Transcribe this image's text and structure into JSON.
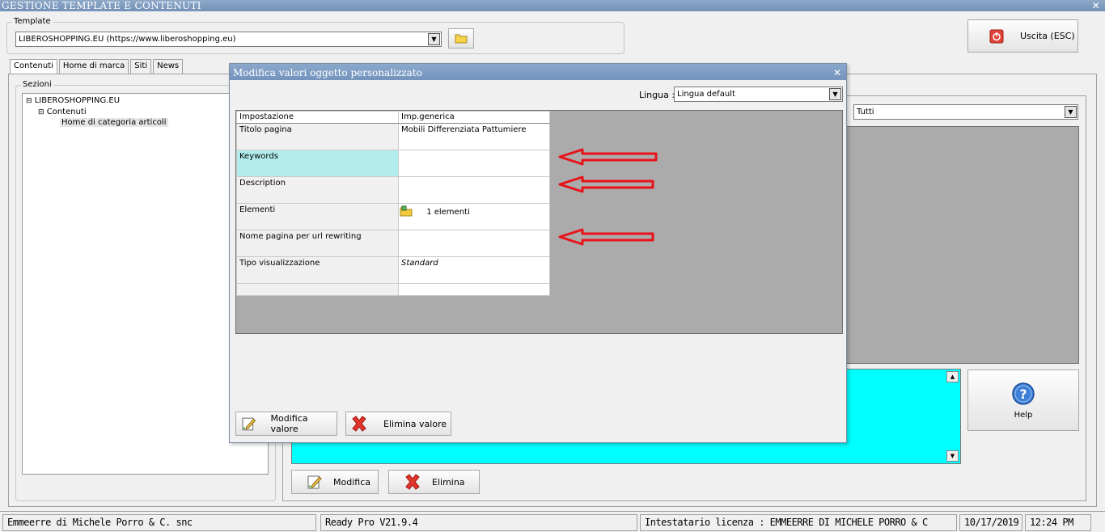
{
  "window": {
    "title": "GESTIONE TEMPLATE E CONTENUTI",
    "close_glyph": "✕"
  },
  "template": {
    "group_label": "Template",
    "selected": "LIBEROSHOPPING.EU (https://www.liberoshopping.eu)"
  },
  "exit_button": {
    "label": "Uscita (ESC)"
  },
  "tabs": [
    {
      "label": "Contenuti"
    },
    {
      "label": "Home di marca"
    },
    {
      "label": "Siti"
    },
    {
      "label": "News"
    }
  ],
  "sections": {
    "group_label": "Sezioni",
    "tree": {
      "root": "LIBEROSHOPPING.EU",
      "child": "Contenuti",
      "leaf": "Home di categoria articoli"
    }
  },
  "right_panel": {
    "filter_selected": "Tutti"
  },
  "help_button": {
    "label": "Help"
  },
  "bottom_buttons": {
    "edit": "Modifica",
    "delete": "Elimina"
  },
  "dialog": {
    "title": "Modifica valori oggetto personalizzato",
    "close_glyph": "✕",
    "language_label": "Lingua :",
    "language_selected": "Lingua default",
    "columns": [
      "Impostazione",
      "Imp.generica"
    ],
    "rows": [
      {
        "setting": "Titolo pagina",
        "value": "Mobili Differenziata Pattumiere"
      },
      {
        "setting": "Keywords",
        "value": ""
      },
      {
        "setting": "Description",
        "value": ""
      },
      {
        "setting": "Elementi",
        "value": "1 elementi"
      },
      {
        "setting": "Nome pagina per url rewriting",
        "value": ""
      },
      {
        "setting": "Tipo visualizzazione",
        "value": "Standard"
      },
      {
        "setting": "",
        "value": ""
      }
    ],
    "edit_button": "Modifica valore",
    "delete_button": "Elimina valore"
  },
  "status": {
    "company": "Emmeerre di Michele Porro & C. snc",
    "version": "Ready Pro V21.9.4",
    "license": "Intestatario licenza : EMMEERRE DI MICHELE PORRO & C",
    "date": "10/17/2019",
    "time": "12:24 PM"
  },
  "colors": {
    "titlebar": "#7d9bc0",
    "selected_row": "#b2ecec",
    "cyan_panel": "#00ffff",
    "grid_background": "#ababab",
    "annotation_arrow": "#e8121a"
  }
}
